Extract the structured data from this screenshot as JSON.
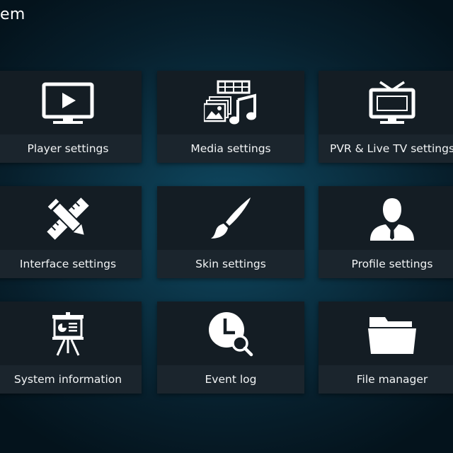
{
  "header": {
    "title": "em"
  },
  "tiles": [
    {
      "label": "Player settings",
      "icon": "tv-play-icon"
    },
    {
      "label": "Media settings",
      "icon": "media-icon"
    },
    {
      "label": "PVR & Live TV settings",
      "icon": "tv-antenna-icon"
    },
    {
      "label": "Interface settings",
      "icon": "pencil-ruler-icon"
    },
    {
      "label": "Skin settings",
      "icon": "paintbrush-icon"
    },
    {
      "label": "Profile settings",
      "icon": "profile-icon"
    },
    {
      "label": "System information",
      "icon": "presentation-easel-icon"
    },
    {
      "label": "Event log",
      "icon": "clock-search-icon"
    },
    {
      "label": "File manager",
      "icon": "folder-icon"
    }
  ],
  "colors": {
    "background": "#0b3447",
    "tile": "#141d24",
    "tile_label_band": "#1b252d",
    "text": "#ffffff"
  }
}
